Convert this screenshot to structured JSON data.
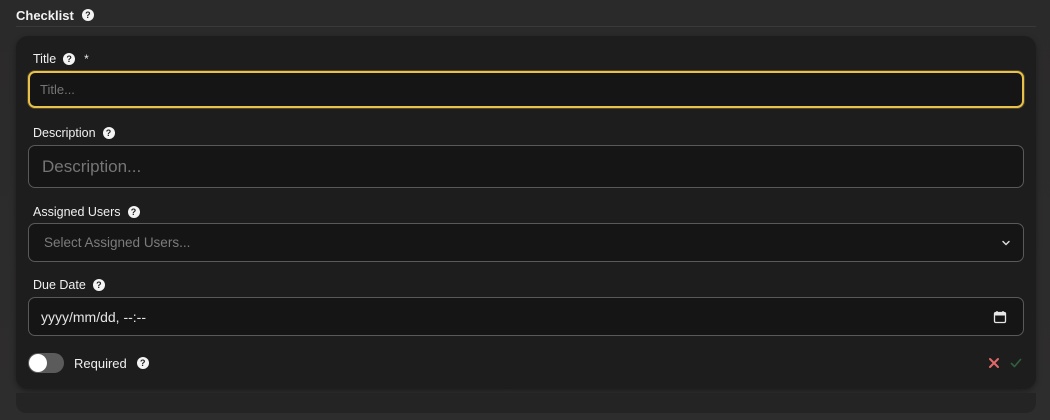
{
  "section": {
    "title": "Checklist",
    "help_icon": "help-icon"
  },
  "fields": {
    "title": {
      "label": "Title",
      "required_mark": "*",
      "placeholder": "Title..."
    },
    "description": {
      "label": "Description",
      "placeholder": "Description..."
    },
    "assigned_users": {
      "label": "Assigned Users",
      "placeholder": "Select Assigned Users..."
    },
    "due_date": {
      "label": "Due Date",
      "value": "yyyy/mm/dd, --:--"
    }
  },
  "required_toggle": {
    "label": "Required",
    "checked": false
  },
  "actions": {
    "cancel_icon": "close-icon",
    "confirm_icon": "check-icon"
  },
  "colors": {
    "accent_focus": "#e8c14a",
    "cancel": "#e36a6a",
    "confirm": "#2f5f3e",
    "panel": "#1e1d1d"
  }
}
